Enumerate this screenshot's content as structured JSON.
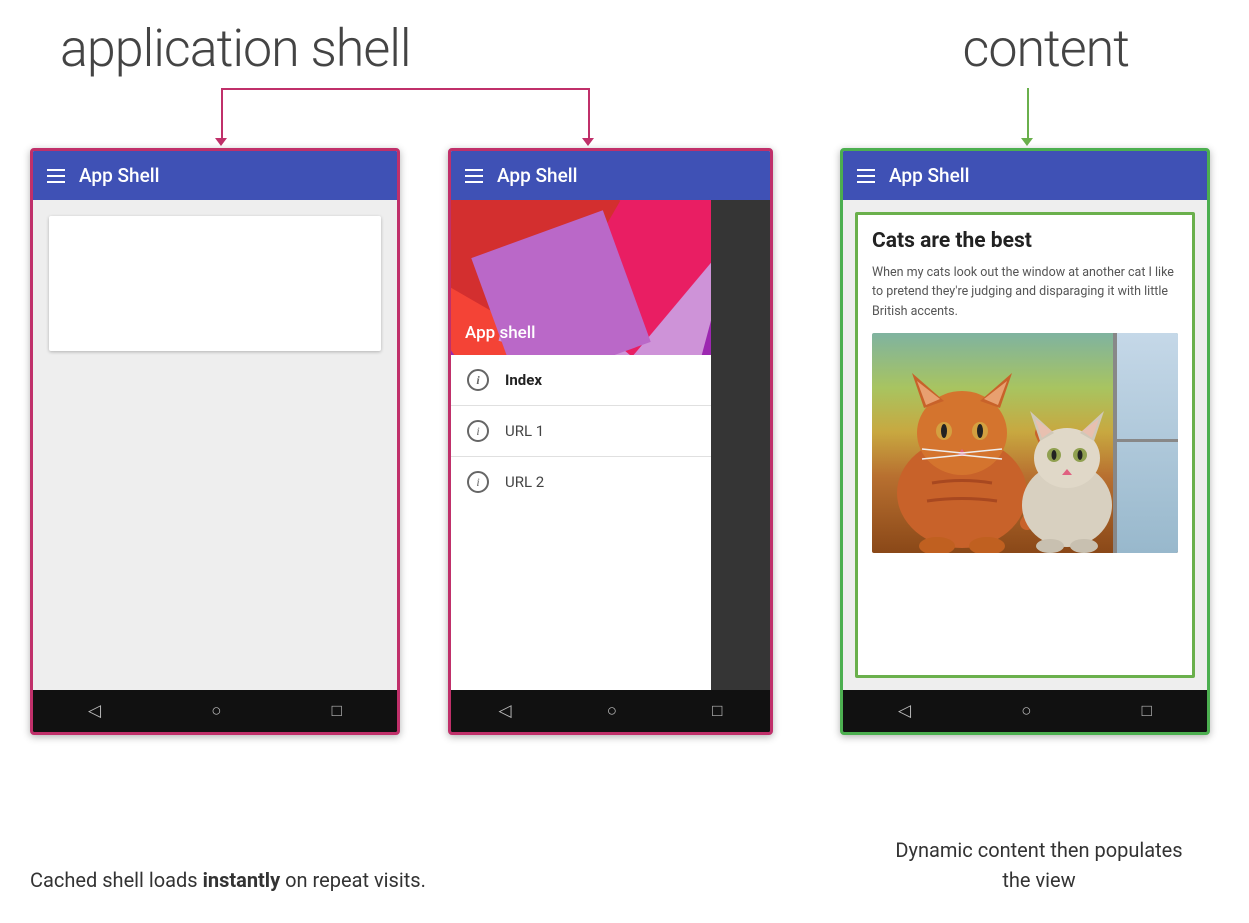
{
  "labels": {
    "application_shell": "application shell",
    "content": "content"
  },
  "phone1": {
    "app_bar_title": "App Shell",
    "nav_back": "◁",
    "nav_home": "○",
    "nav_recent": "□"
  },
  "phone2": {
    "app_bar_title": "App Shell",
    "drawer_header_label": "App shell",
    "drawer_items": [
      {
        "label": "Index",
        "bold": true
      },
      {
        "label": "URL 1",
        "bold": false
      },
      {
        "label": "URL 2",
        "bold": false
      }
    ],
    "nav_back": "◁",
    "nav_home": "○",
    "nav_recent": "□"
  },
  "phone3": {
    "app_bar_title": "App Shell",
    "content_title": "Cats are the best",
    "content_text": "When my cats look out the window at another cat I like to pretend they're judging and disparaging it with little British accents.",
    "nav_back": "◁",
    "nav_home": "○",
    "nav_recent": "□"
  },
  "captions": {
    "left_part1": "Cached shell loads ",
    "left_bold": "instantly",
    "left_part2": " on repeat visits.",
    "right": "Dynamic content then populates the view"
  }
}
